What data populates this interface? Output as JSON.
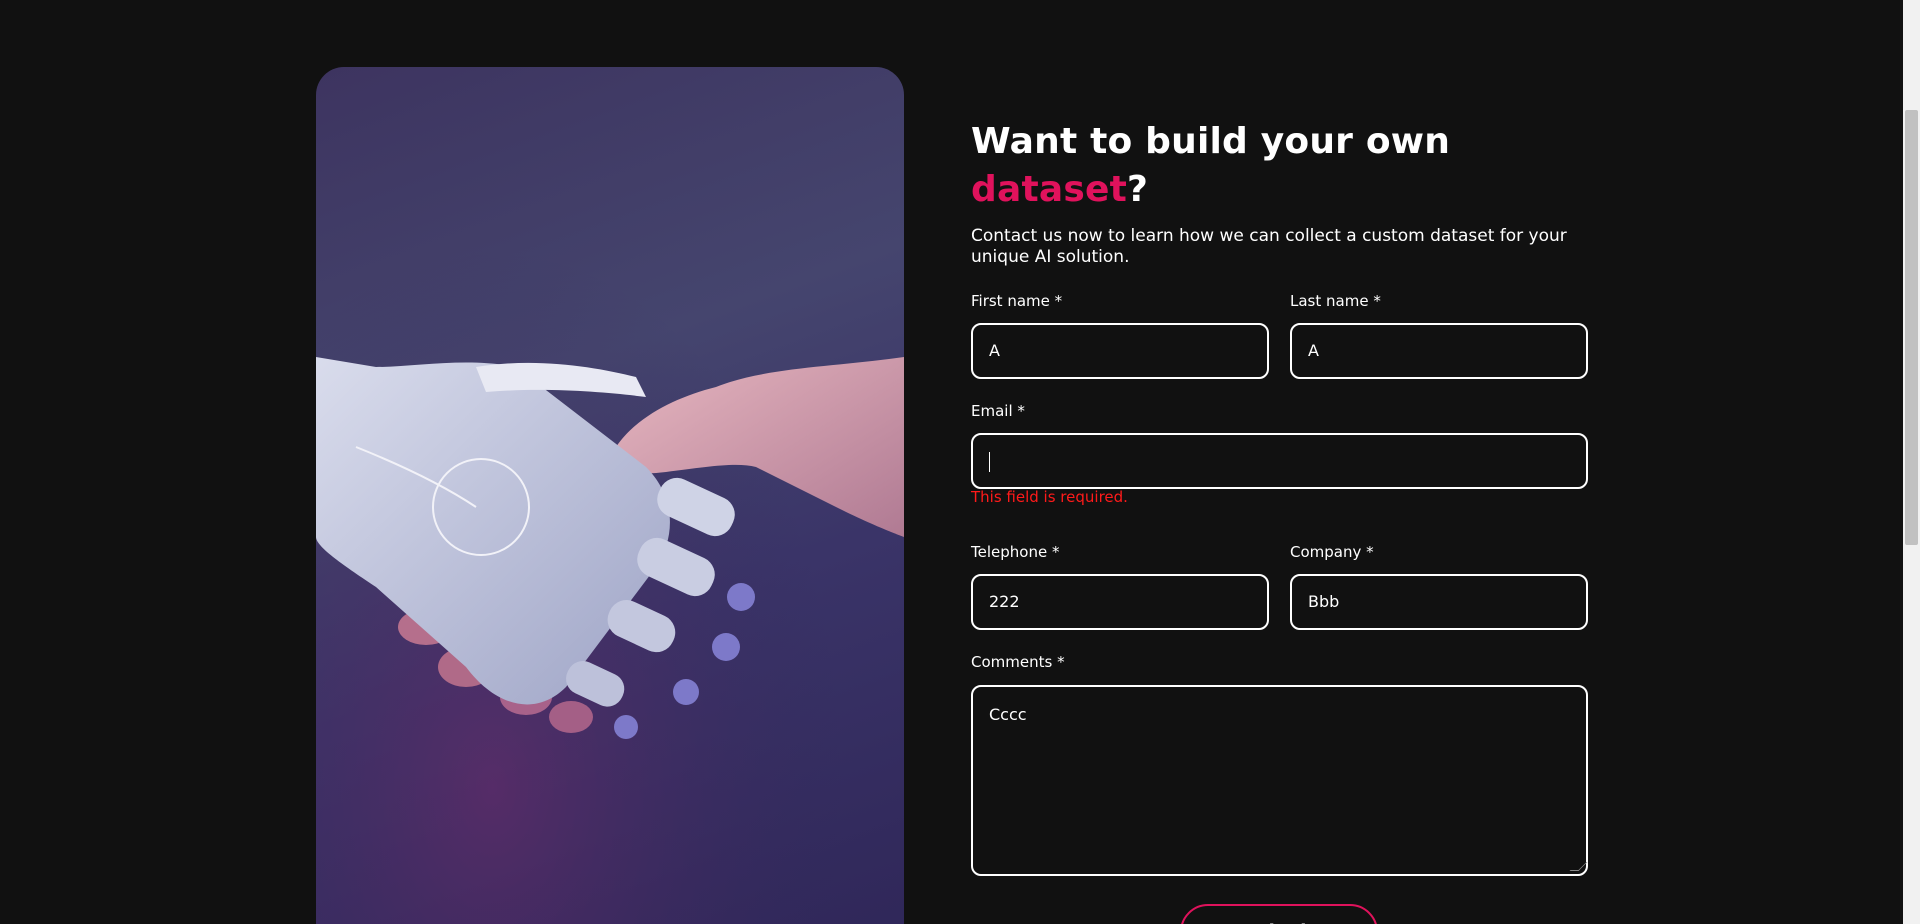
{
  "heading": {
    "prefix": "Want to build your own ",
    "accent": "dataset",
    "suffix": "?"
  },
  "subtitle": "Contact us now to learn how we can collect a custom dataset for your unique AI solution.",
  "form": {
    "first_name": {
      "label": "First name *",
      "value": "A"
    },
    "last_name": {
      "label": "Last name *",
      "value": "A"
    },
    "email": {
      "label": "Email *",
      "value": "",
      "error": "This field is required."
    },
    "telephone": {
      "label": "Telephone *",
      "value": "222"
    },
    "company": {
      "label": "Company *",
      "value": "Bbb"
    },
    "comments": {
      "label": "Comments *",
      "value": "Cccc"
    },
    "submit_label": "Submit"
  },
  "colors": {
    "background": "#111111",
    "accent": "#e0125c",
    "error": "#ff1a1a"
  }
}
